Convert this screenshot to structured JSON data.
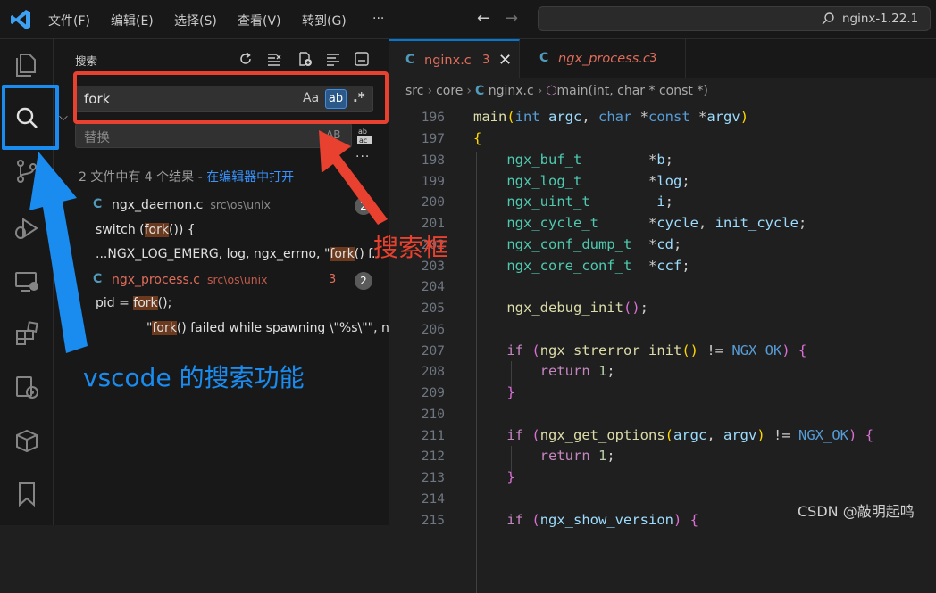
{
  "titlebar": {
    "menus": [
      "文件(F)",
      "编辑(E)",
      "选择(S)",
      "查看(V)",
      "转到(G)",
      "···"
    ],
    "command_center": "nginx-1.22.1"
  },
  "activity_bar": {
    "items": [
      "explorer-icon",
      "search-icon",
      "source-control-icon",
      "run-debug-icon",
      "remote-explorer-icon",
      "extensions-icon",
      "docker-icon",
      "container-icon",
      "bookmark-icon"
    ]
  },
  "sidebar": {
    "title": "搜索",
    "search_value": "fork",
    "replace_placeholder": "替换",
    "match_case_label": "Aa",
    "whole_word_label": "ab",
    "regex_label": ".*",
    "preserve_case_label": "AB",
    "summary": "2 文件中有 4 个结果 - ",
    "open_in_editor": "在编辑器中打开",
    "results": [
      {
        "file": "ngx_daemon.c",
        "path": "src\\os\\unix",
        "count": "2",
        "modified": false,
        "errors": "",
        "matches": [
          {
            "before": "switch (",
            "hit": "fork",
            "after": "()) {"
          },
          {
            "before": "...NGX_LOG_EMERG, log, ngx_errno, \"",
            "hit": "fork",
            "after": "() f..."
          }
        ]
      },
      {
        "file": "ngx_process.c",
        "path": "src\\os\\unix",
        "count": "2",
        "modified": true,
        "errors": "3",
        "matches": [
          {
            "before": "pid = ",
            "hit": "fork",
            "after": "();"
          },
          {
            "before": "\"",
            "hit": "fork",
            "after": "() failed while spawning \\\"%s\\\"\", name);"
          }
        ]
      }
    ]
  },
  "annotations": {
    "search_box_label": "搜索框",
    "feature_label": "vscode 的搜索功能",
    "colors": {
      "red": "#e8412f",
      "blue": "#1a8cf0"
    }
  },
  "editor": {
    "tabs": [
      {
        "name": "nginx.c",
        "problems": "3",
        "active": true
      },
      {
        "name": "ngx_process.c",
        "problems": "3",
        "active": false
      }
    ],
    "breadcrumb": [
      "src",
      "core",
      "nginx.c",
      "main(int, char * const *)"
    ],
    "code_lines": [
      {
        "n": "196"
      },
      {
        "n": "197"
      },
      {
        "n": "198"
      },
      {
        "n": "199"
      },
      {
        "n": "200"
      },
      {
        "n": "201"
      },
      {
        "n": "202"
      },
      {
        "n": "203"
      },
      {
        "n": "204"
      },
      {
        "n": "205"
      },
      {
        "n": "206"
      },
      {
        "n": "207"
      },
      {
        "n": "208"
      },
      {
        "n": "209"
      },
      {
        "n": "210"
      },
      {
        "n": "211"
      },
      {
        "n": "212"
      },
      {
        "n": "213"
      },
      {
        "n": "214"
      },
      {
        "n": "215"
      }
    ]
  },
  "watermark": "CSDN @敲明起鸣"
}
